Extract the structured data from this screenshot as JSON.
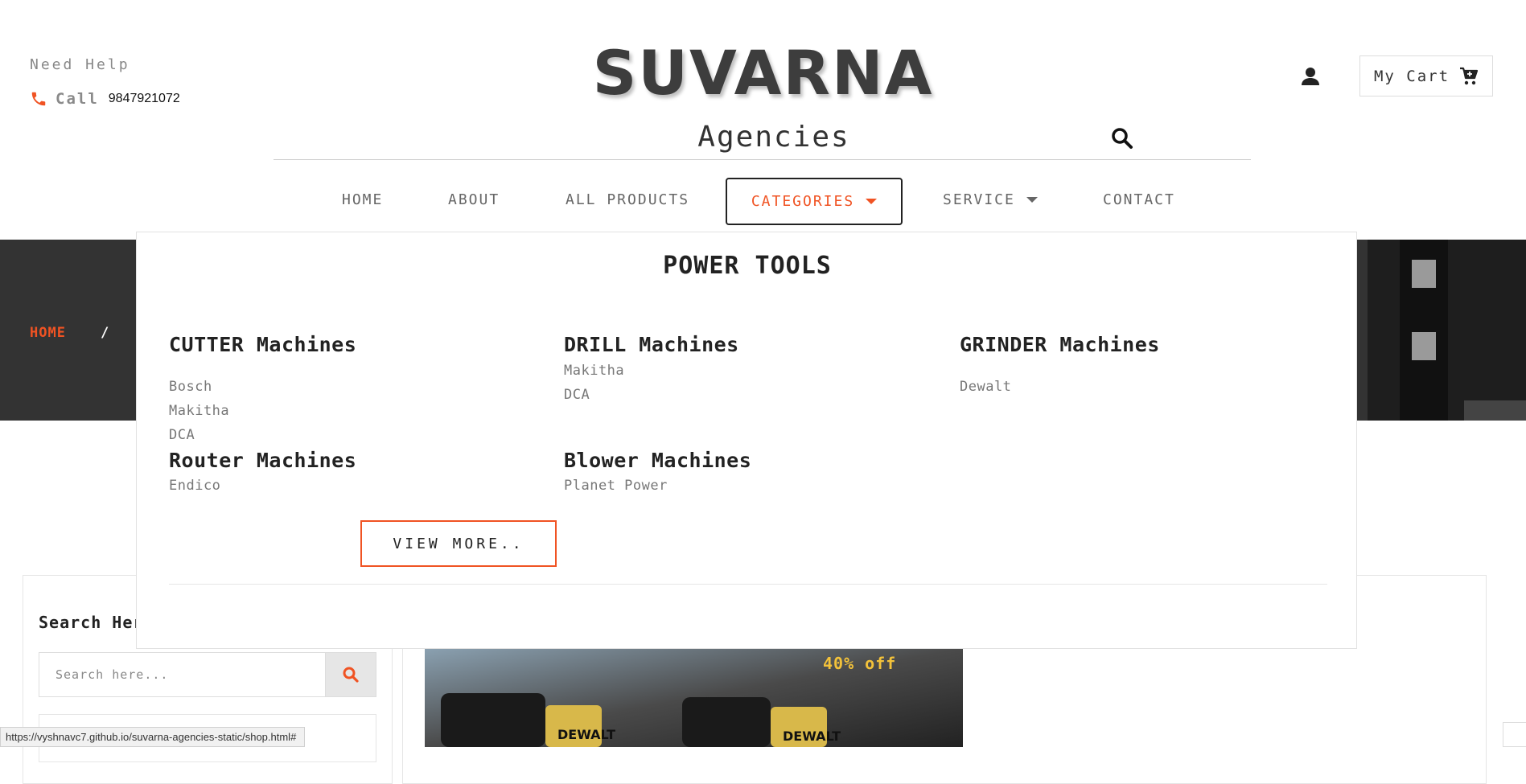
{
  "header": {
    "help_label": "Need Help",
    "call_label": "Call",
    "phone_number": "9847921072",
    "brand_title": "SUVARNA",
    "brand_subtitle": "Agencies",
    "cart_label": "My Cart"
  },
  "nav": {
    "items": [
      {
        "label": "HOME"
      },
      {
        "label": "ABOUT"
      },
      {
        "label": "ALL PRODUCTS"
      },
      {
        "label": "CATEGORIES",
        "active": true
      },
      {
        "label": "SERVICE"
      },
      {
        "label": "CONTACT"
      }
    ]
  },
  "breadcrumb": {
    "home": "HOME",
    "separator": "/"
  },
  "mega_menu": {
    "title": "POWER TOOLS",
    "columns": [
      {
        "title": "CUTTER Machines",
        "links": [
          "Bosch",
          "Makitha",
          "DCA"
        ]
      },
      {
        "title": "DRILL Machines",
        "links": [
          "Makitha",
          "DCA"
        ]
      },
      {
        "title": "GRINDER Machines",
        "links": [
          "Dewalt"
        ]
      },
      {
        "title": "Router Machines",
        "links": [
          "Endico"
        ]
      },
      {
        "title": "Blower Machines",
        "links": [
          "Planet Power"
        ]
      }
    ],
    "view_more_label": "VIEW MORE.."
  },
  "sidebar": {
    "search_title": "Search Here",
    "search_placeholder": "Search here..."
  },
  "product": {
    "discount": "40% off",
    "brand_text": "DEWALT"
  },
  "status_bar": {
    "url": "https://vyshnavc7.github.io/suvarna-agencies-static/shop.html#"
  },
  "colors": {
    "accent": "#f05323",
    "banner": "#2d2d2d",
    "discount": "#f3c23a",
    "text_dark": "#222222",
    "text_muted": "#777777"
  }
}
